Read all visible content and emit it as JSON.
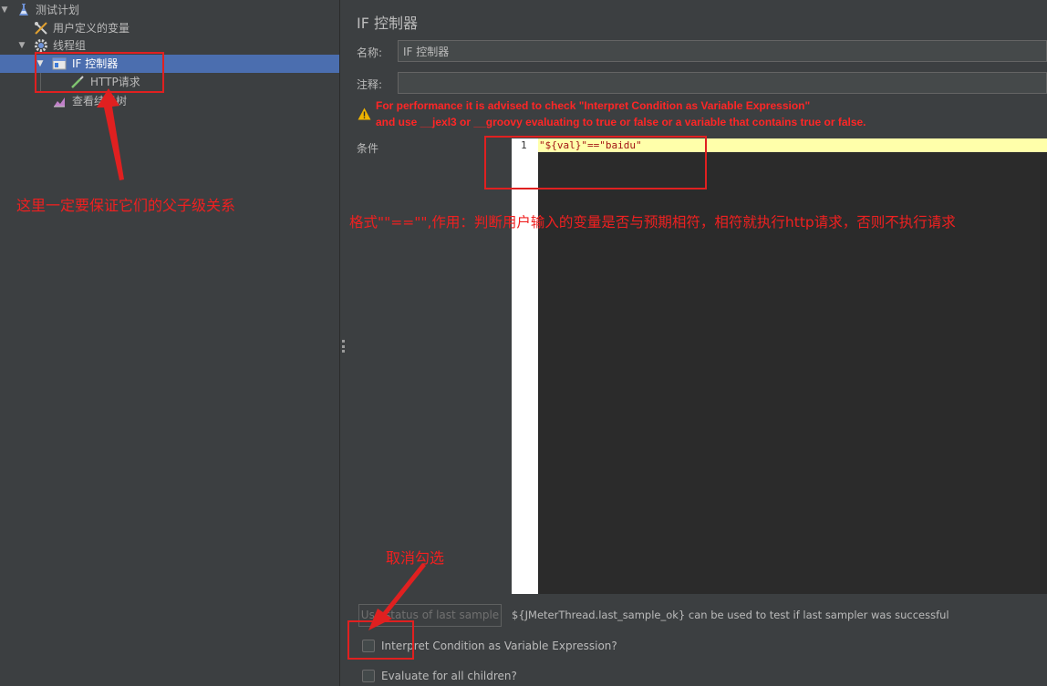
{
  "tree": {
    "nodes": [
      {
        "label": "测试计划",
        "icon": "flask-icon"
      },
      {
        "label": "用户定义的变量",
        "icon": "tools-icon"
      },
      {
        "label": "线程组",
        "icon": "gear-icon"
      },
      {
        "label": "IF 控制器",
        "icon": "if-controller-icon"
      },
      {
        "label": "HTTP请求",
        "icon": "pipette-icon"
      },
      {
        "label": "查看结果树",
        "icon": "chart-icon"
      }
    ]
  },
  "panel": {
    "title": "IF 控制器",
    "name_label": "名称:",
    "name_value": "IF 控制器",
    "comment_label": "注释:",
    "comment_value": "",
    "warning_line1": "For performance it is advised to check \"Interpret Condition as Variable Expression\"",
    "warning_line2": "and use __jexl3 or __groovy evaluating to true or false or a variable that contains true or false.",
    "condition_label": "条件",
    "editor": {
      "line_number": "1",
      "code": "\"${val}\"==\"baidu\""
    },
    "use_status_button": "Use status of last sample",
    "status_hint": "${JMeterThread.last_sample_ok} can be used to test if last sampler was successful",
    "checkbox_interpret": {
      "label": "Interpret Condition as Variable Expression?",
      "checked": false
    },
    "checkbox_evaluate_all": {
      "label": "Evaluate for all children?",
      "checked": false
    }
  },
  "annotations": {
    "parent_child_note": "这里一定要保证它们的父子级关系",
    "format_note": "格式\"\"==\"\",作用：判断用户输入的变量是否与预期相符，相符就执行http请求，否则不执行请求",
    "uncheck_note": "取消勾选",
    "color": "#f02020"
  },
  "colors": {
    "background": "#3c3f41",
    "selection": "#4b6eaf",
    "warning_text": "#ff2626",
    "editor_highlight": "#ffffaa"
  }
}
